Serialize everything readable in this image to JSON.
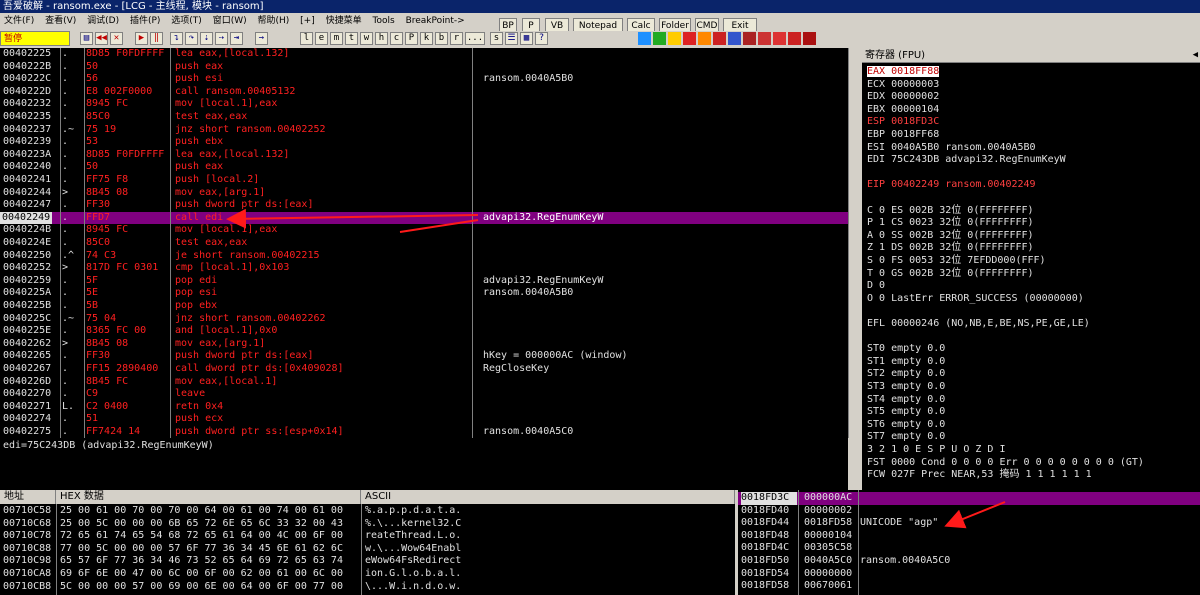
{
  "window": {
    "title": "吾爱破解 - ransom.exe - [LCG - 主线程, 模块 - ransom]"
  },
  "menu": [
    {
      "label": "文件(F)"
    },
    {
      "label": "查看(V)"
    },
    {
      "label": "调试(D)"
    },
    {
      "label": "插件(P)"
    },
    {
      "label": "选项(T)"
    },
    {
      "label": "窗口(W)"
    },
    {
      "label": "帮助(H)"
    },
    {
      "label": "[+]"
    },
    {
      "label": "快捷菜单"
    },
    {
      "label": "Tools"
    },
    {
      "label": "BreakPoint->"
    }
  ],
  "plugins": [
    {
      "label": "BP"
    },
    {
      "label": "P"
    },
    {
      "label": "VB"
    },
    {
      "label": "Notepad"
    },
    {
      "label": "Calc"
    },
    {
      "label": "Folder"
    },
    {
      "label": "CMD"
    },
    {
      "label": "Exit"
    }
  ],
  "toolbar": {
    "status": "暂停",
    "letters": [
      "l",
      "e",
      "m",
      "t",
      "w",
      "h",
      "c",
      "P",
      "k",
      "b",
      "r",
      "...",
      "s"
    ]
  },
  "cpu": {
    "rows": [
      {
        "addr": "00402225",
        "mark": ".",
        "hex": "8D85 F0FDFFFF",
        "dis": "lea eax,[local.132]",
        "comment": ""
      },
      {
        "addr": "0040222B",
        "mark": ".",
        "hex": "50",
        "dis": "push eax",
        "comment": ""
      },
      {
        "addr": "0040222C",
        "mark": ".",
        "hex": "56",
        "dis": "push esi",
        "comment": "ransom.0040A5B0"
      },
      {
        "addr": "0040222D",
        "mark": ".",
        "hex": "E8 002F0000",
        "dis": "call ransom.00405132",
        "comment": ""
      },
      {
        "addr": "00402232",
        "mark": ".",
        "hex": "8945 FC",
        "dis": "mov [local.1],eax",
        "comment": ""
      },
      {
        "addr": "00402235",
        "mark": ".",
        "hex": "85C0",
        "dis": "test eax,eax",
        "comment": ""
      },
      {
        "addr": "00402237",
        "mark": ".~",
        "hex": "75 19",
        "dis": "jnz short ransom.00402252",
        "comment": ""
      },
      {
        "addr": "00402239",
        "mark": ".",
        "hex": "53",
        "dis": "push ebx",
        "comment": ""
      },
      {
        "addr": "0040223A",
        "mark": ".",
        "hex": "8D85 F0FDFFFF",
        "dis": "lea eax,[local.132]",
        "comment": ""
      },
      {
        "addr": "00402240",
        "mark": ".",
        "hex": "50",
        "dis": "push eax",
        "comment": ""
      },
      {
        "addr": "00402241",
        "mark": ".",
        "hex": "FF75 F8",
        "dis": "push [local.2]",
        "comment": ""
      },
      {
        "addr": "00402244",
        "mark": ">",
        "hex": "8B45 08",
        "dis": "mov eax,[arg.1]",
        "comment": ""
      },
      {
        "addr": "00402247",
        "mark": ".",
        "hex": "FF30",
        "dis": "push dword ptr ds:[eax]",
        "comment": ""
      },
      {
        "addr": "00402249",
        "mark": ".",
        "hex": "FFD7",
        "dis": "call edi",
        "comment": "advapi32.RegEnumKeyW",
        "sel": true
      },
      {
        "addr": "0040224B",
        "mark": ".",
        "hex": "8945 FC",
        "dis": "mov [local.1],eax",
        "comment": ""
      },
      {
        "addr": "0040224E",
        "mark": ".",
        "hex": "85C0",
        "dis": "test eax,eax",
        "comment": ""
      },
      {
        "addr": "00402250",
        "mark": ".^",
        "hex": "74 C3",
        "dis": "je short ransom.00402215",
        "comment": ""
      },
      {
        "addr": "00402252",
        "mark": ">",
        "hex": "817D FC 0301",
        "dis": "cmp [local.1],0x103",
        "comment": ""
      },
      {
        "addr": "00402259",
        "mark": ".",
        "hex": "5F",
        "dis": "pop edi",
        "comment": "advapi32.RegEnumKeyW"
      },
      {
        "addr": "0040225A",
        "mark": ".",
        "hex": "5E",
        "dis": "pop esi",
        "comment": "ransom.0040A5B0"
      },
      {
        "addr": "0040225B",
        "mark": ".",
        "hex": "5B",
        "dis": "pop ebx",
        "comment": ""
      },
      {
        "addr": "0040225C",
        "mark": ".~",
        "hex": "75 04",
        "dis": "jnz short ransom.00402262",
        "comment": ""
      },
      {
        "addr": "0040225E",
        "mark": ".",
        "hex": "8365 FC 00",
        "dis": "and [local.1],0x0",
        "comment": ""
      },
      {
        "addr": "00402262",
        "mark": ">",
        "hex": "8B45 08",
        "dis": "mov eax,[arg.1]",
        "comment": ""
      },
      {
        "addr": "00402265",
        "mark": ".",
        "hex": "FF30",
        "dis": "push dword ptr ds:[eax]",
        "comment": "hKey = 000000AC (window)"
      },
      {
        "addr": "00402267",
        "mark": ".",
        "hex": "FF15 2890400",
        "dis": "call dword ptr ds:[0x409028]",
        "comment": "RegCloseKey"
      },
      {
        "addr": "0040226D",
        "mark": ".",
        "hex": "8B45 FC",
        "dis": "mov eax,[local.1]",
        "comment": ""
      },
      {
        "addr": "00402270",
        "mark": ".",
        "hex": "C9",
        "dis": "leave",
        "comment": ""
      },
      {
        "addr": "00402271",
        "mark": "L.",
        "hex": "C2 0400",
        "dis": "retn 0x4",
        "comment": ""
      },
      {
        "addr": "00402274",
        "mark": ".",
        "hex": "51",
        "dis": "push ecx",
        "comment": ""
      },
      {
        "addr": "00402275",
        "mark": ".",
        "hex": "FF7424 14",
        "dis": "push dword ptr ss:[esp+0x14]",
        "comment": "ransom.0040A5C0"
      }
    ]
  },
  "info": {
    "text": "edi=75C243DB (advapi32.RegEnumKeyW)"
  },
  "registers": {
    "title": "寄存器 (FPU)",
    "lines": [
      {
        "t": "EAX 0018FF88",
        "hl": true
      },
      {
        "t": "ECX 00000003"
      },
      {
        "t": "EDX 00000002"
      },
      {
        "t": "EBX 00000104"
      },
      {
        "t": "ESP 0018FD3C",
        "red": true
      },
      {
        "t": "EBP 0018FF68"
      },
      {
        "t": "ESI 0040A5B0 ransom.0040A5B0"
      },
      {
        "t": "EDI 75C243DB advapi32.RegEnumKeyW"
      },
      {
        "t": ""
      },
      {
        "t": "EIP 00402249 ransom.00402249",
        "red": true
      },
      {
        "t": ""
      },
      {
        "t": "C 0  ES 002B 32位 0(FFFFFFFF)"
      },
      {
        "t": "P 1  CS 0023 32位 0(FFFFFFFF)"
      },
      {
        "t": "A 0  SS 002B 32位 0(FFFFFFFF)"
      },
      {
        "t": "Z 1  DS 002B 32位 0(FFFFFFFF)"
      },
      {
        "t": "S 0  FS 0053 32位 7EFDD000(FFF)"
      },
      {
        "t": "T 0  GS 002B 32位 0(FFFFFFFF)"
      },
      {
        "t": "D 0"
      },
      {
        "t": "O 0  LastErr ERROR_SUCCESS (00000000)"
      },
      {
        "t": ""
      },
      {
        "t": "EFL 00000246 (NO,NB,E,BE,NS,PE,GE,LE)"
      },
      {
        "t": ""
      },
      {
        "t": "ST0 empty 0.0"
      },
      {
        "t": "ST1 empty 0.0"
      },
      {
        "t": "ST2 empty 0.0"
      },
      {
        "t": "ST3 empty 0.0"
      },
      {
        "t": "ST4 empty 0.0"
      },
      {
        "t": "ST5 empty 0.0"
      },
      {
        "t": "ST6 empty 0.0"
      },
      {
        "t": "ST7 empty 0.0"
      },
      {
        "t": "               3 2 1 0      E S P U O Z D I"
      },
      {
        "t": "FST 0000  Cond 0 0 0 0  Err 0 0 0 0 0 0 0 0  (GT)"
      },
      {
        "t": "FCW 027F  Prec NEAR,53  掩码    1 1 1 1 1 1"
      }
    ]
  },
  "dump": {
    "headers": {
      "addr": "地址",
      "hex": "HEX 数据",
      "ascii": "ASCII"
    },
    "rows": [
      {
        "addr": "00710C58",
        "hex": "25 00 61 00 70 00 70 00 64 00 61 00 74 00 61 00",
        "ascii": "%.a.p.p.d.a.t.a."
      },
      {
        "addr": "00710C68",
        "hex": "25 00 5C 00 00 00 6B 65 72 6E 65 6C 33 32 00 43",
        "ascii": "%.\\...kernel32.C"
      },
      {
        "addr": "00710C78",
        "hex": "72 65 61 74 65 54 68 72 65 61 64 00 4C 00 6F 00",
        "ascii": "reateThread.L.o."
      },
      {
        "addr": "00710C88",
        "hex": "77 00 5C 00 00 00 57 6F 77 36 34 45 6E 61 62 6C",
        "ascii": "w.\\...Wow64Enabl"
      },
      {
        "addr": "00710C98",
        "hex": "65 57 6F 77 36 34 46 73 52 65 64 69 72 65 63 74",
        "ascii": "eWow64FsRedirect"
      },
      {
        "addr": "00710CA8",
        "hex": "69 6F 6E 00 47 00 6C 00 6F 00 62 00 61 00 6C 00",
        "ascii": "ion.G.l.o.b.a.l."
      },
      {
        "addr": "00710CB8",
        "hex": "5C 00 00 00 57 00 69 00 6E 00 64 00 6F 00 77 00",
        "ascii": "\\...W.i.n.d.o.w."
      }
    ]
  },
  "stack": {
    "rows": [
      {
        "addr": "0018FD3C",
        "val": "000000AC",
        "comment": "",
        "top": true
      },
      {
        "addr": "0018FD40",
        "val": "00000002",
        "comment": ""
      },
      {
        "addr": "0018FD44",
        "val": "0018FD58",
        "comment": "UNICODE \"agp\""
      },
      {
        "addr": "0018FD48",
        "val": "00000104",
        "comment": ""
      },
      {
        "addr": "0018FD4C",
        "val": "00305C58",
        "comment": ""
      },
      {
        "addr": "0018FD50",
        "val": "0040A5C0",
        "comment": "ransom.0040A5C0"
      },
      {
        "addr": "0018FD54",
        "val": "00000000",
        "comment": ""
      },
      {
        "addr": "0018FD58",
        "val": "00670061",
        "comment": ""
      }
    ]
  },
  "colors": {
    "accent": "#800080",
    "arrow": "#ff1a1a",
    "background": "#000000",
    "text": "#e0e0e0",
    "code": "#ff2020"
  }
}
